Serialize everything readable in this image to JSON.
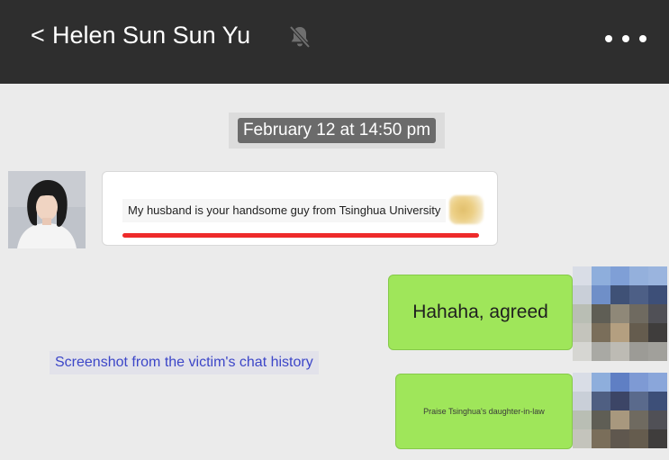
{
  "header": {
    "back_glyph": "<",
    "title": "Helen Sun Sun Yu",
    "mute_icon": "bell-slash-icon",
    "more_icon": "ellipsis-icon"
  },
  "chat": {
    "timestamp": "February 12 at 14:50 pm",
    "messages": [
      {
        "side": "left",
        "text": "My husband is your handsome guy from Tsinghua University",
        "highlight_color": "#ee2a2a"
      },
      {
        "side": "right",
        "text": "Hahaha, agreed"
      },
      {
        "side": "right",
        "text": "Praise Tsinghua's daughter-in-law"
      }
    ]
  },
  "caption": {
    "text": "Screenshot from the victim's chat history"
  },
  "colors": {
    "header_bg": "#2e2e2e",
    "chat_bg": "#ebebeb",
    "sent_bubble": "#9fe65a",
    "caption_text": "#3c46c8"
  }
}
